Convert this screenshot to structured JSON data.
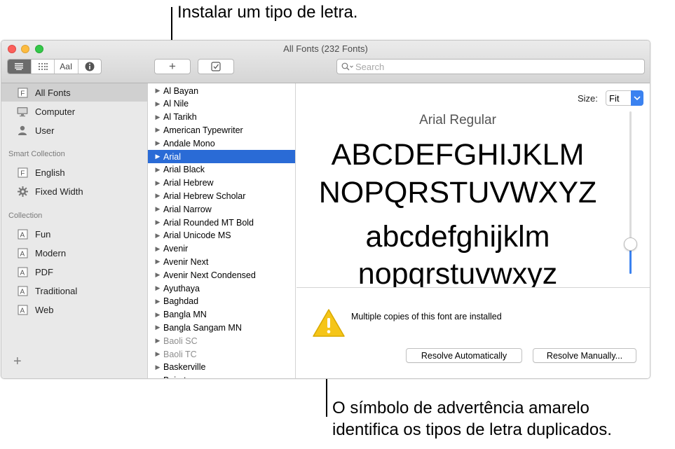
{
  "annotations": {
    "top": "Instalar um tipo de letra.",
    "bottom_line1": "O símbolo de advertência amarelo",
    "bottom_line2": "identifica os tipos de letra duplicados."
  },
  "window": {
    "title": "All Fonts (232 Fonts)"
  },
  "toolbar": {
    "view_buttons": [
      {
        "icon": "list-view-icon",
        "active": true
      },
      {
        "icon": "grid-view-icon",
        "active": false
      },
      {
        "icon": "sample-text-icon",
        "label": "AaI",
        "active": false
      },
      {
        "icon": "info-icon",
        "active": false
      }
    ],
    "add_label": "+",
    "validate_icon": "checkbox-icon",
    "search_placeholder": "Search"
  },
  "sidebar": {
    "library_items": [
      {
        "label": "All Fonts",
        "icon": "font-book-icon",
        "selected": true
      },
      {
        "label": "Computer",
        "icon": "computer-icon",
        "selected": false
      },
      {
        "label": "User",
        "icon": "user-icon",
        "selected": false
      }
    ],
    "smart_heading": "Smart Collection",
    "smart_items": [
      {
        "label": "English",
        "icon": "font-book-icon"
      },
      {
        "label": "Fixed Width",
        "icon": "gear-icon"
      }
    ],
    "collection_heading": "Collection",
    "collection_items": [
      {
        "label": "Fun"
      },
      {
        "label": "Modern"
      },
      {
        "label": "PDF"
      },
      {
        "label": "Traditional"
      },
      {
        "label": "Web"
      }
    ],
    "add_label": "+"
  },
  "fonts": [
    {
      "name": "Al Bayan"
    },
    {
      "name": "Al Nile"
    },
    {
      "name": "Al Tarikh"
    },
    {
      "name": "American Typewriter"
    },
    {
      "name": "Andale Mono"
    },
    {
      "name": "Arial",
      "selected": true
    },
    {
      "name": "Arial Black"
    },
    {
      "name": "Arial Hebrew"
    },
    {
      "name": "Arial Hebrew Scholar"
    },
    {
      "name": "Arial Narrow"
    },
    {
      "name": "Arial Rounded MT Bold"
    },
    {
      "name": "Arial Unicode MS"
    },
    {
      "name": "Avenir"
    },
    {
      "name": "Avenir Next"
    },
    {
      "name": "Avenir Next Condensed"
    },
    {
      "name": "Ayuthaya"
    },
    {
      "name": "Baghdad"
    },
    {
      "name": "Bangla MN"
    },
    {
      "name": "Bangla Sangam MN"
    },
    {
      "name": "Baoli SC",
      "dim": true
    },
    {
      "name": "Baoli TC",
      "dim": true
    },
    {
      "name": "Baskerville"
    },
    {
      "name": "Beirut"
    }
  ],
  "preview": {
    "size_label": "Size:",
    "size_value": "Fit",
    "font_name": "Arial Regular",
    "sample_lines": [
      "ABCDEFGHIJKLM",
      "NOPQRSTUVWXYZ",
      "abcdefghijklm",
      "nopqrstuvwxyz"
    ],
    "slider_level": 0.18
  },
  "warning": {
    "icon": "warning-triangle-icon",
    "message": "Multiple copies of this font are installed",
    "resolve_auto_label": "Resolve Automatically",
    "resolve_manual_label": "Resolve Manually..."
  },
  "colors": {
    "selection": "#2a6bd6",
    "accent": "#3b82f0",
    "warning": "#f5c518"
  }
}
